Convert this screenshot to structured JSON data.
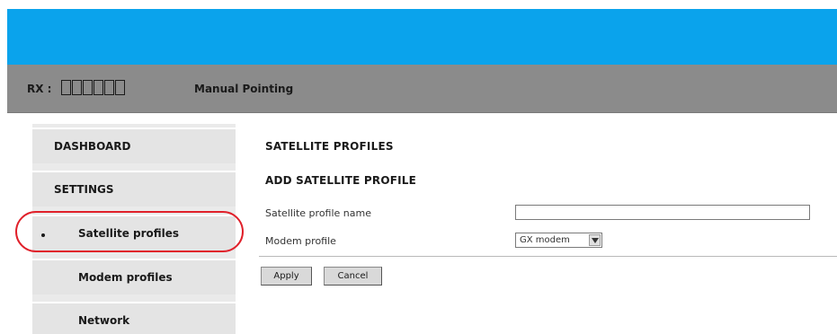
{
  "header": {
    "rx_label": "RX :",
    "page_title": "Manual Pointing",
    "band_color": "#0aa3ec",
    "status_bar_color": "#8b8b8b"
  },
  "sidebar": {
    "items": [
      {
        "label": "DASHBOARD",
        "level": "top",
        "active": false
      },
      {
        "label": "SETTINGS",
        "level": "top",
        "active": false
      },
      {
        "label": "Satellite profiles",
        "level": "sub",
        "active": true
      },
      {
        "label": "Modem profiles",
        "level": "sub",
        "active": false
      },
      {
        "label": "Network",
        "level": "sub",
        "active": false
      }
    ],
    "highlight_color": "#e0202a"
  },
  "main": {
    "section_title": "SATELLITE PROFILES",
    "subsection_title": "ADD SATELLITE PROFILE",
    "fields": {
      "profile_name_label": "Satellite profile name",
      "profile_name_value": "",
      "modem_profile_label": "Modem profile",
      "modem_profile_value": "GX modem"
    },
    "buttons": {
      "apply": "Apply",
      "cancel": "Cancel"
    }
  }
}
